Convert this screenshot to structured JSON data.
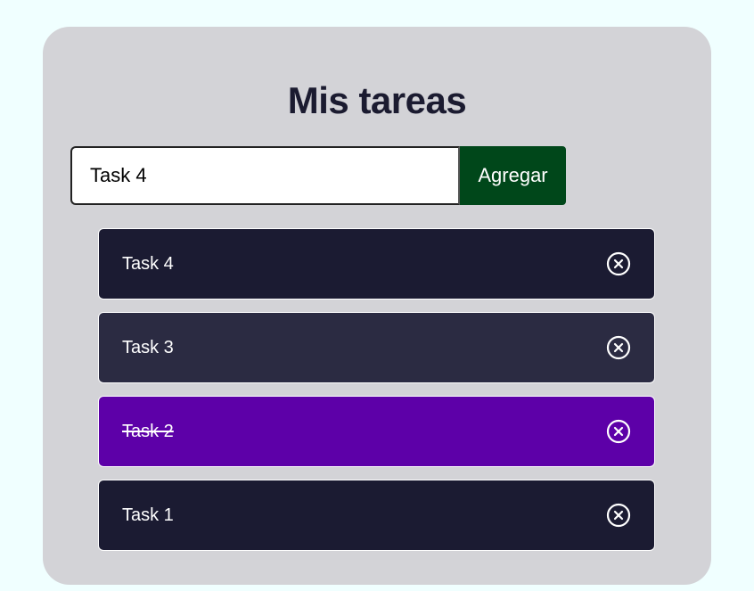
{
  "app": {
    "title": "Mis tareas"
  },
  "form": {
    "input_value": "Task 4",
    "button_label": "Agregar"
  },
  "tasks": [
    {
      "text": "Task 4",
      "completed": false,
      "style": "dark"
    },
    {
      "text": "Task 3",
      "completed": false,
      "style": "medium"
    },
    {
      "text": "Task 2",
      "completed": true,
      "style": "done"
    },
    {
      "text": "Task 1",
      "completed": false,
      "style": "dark"
    }
  ],
  "icons": {
    "delete": "close-circle-icon"
  },
  "colors": {
    "page_background": "#f0ffff",
    "card_background": "#d3d3d7",
    "title": "#1b1b30",
    "add_button": "#00471a",
    "task_dark": "#1b1b32",
    "task_medium": "#2b2b42",
    "task_completed": "#5d00a8"
  }
}
